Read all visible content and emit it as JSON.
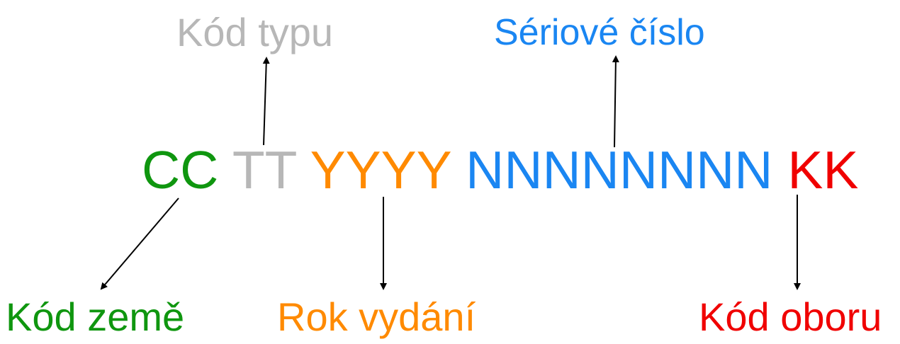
{
  "colors": {
    "green": "#0f960f",
    "gray": "#b7b7b7",
    "orange": "#ff8a00",
    "blue": "#1a86f2",
    "red": "#f00000",
    "arrow": "#000000"
  },
  "code": {
    "country": "CC",
    "type": "TT",
    "year": "YYYY",
    "serial": "NNNNNNNN",
    "field": "KK"
  },
  "labels": {
    "type": "Kód typu",
    "serial": "Sériové číslo",
    "country": "Kód země",
    "year": "Rok vydání",
    "field": "Kód oboru"
  }
}
